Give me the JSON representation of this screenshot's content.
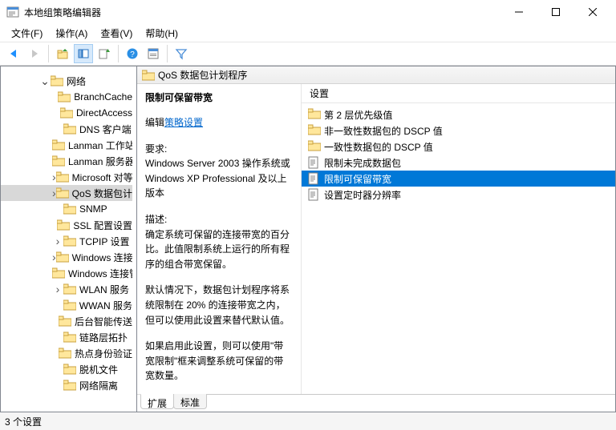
{
  "window": {
    "title": "本地组策略编辑器"
  },
  "menu": {
    "file": "文件(F)",
    "action": "操作(A)",
    "view": "查看(V)",
    "help": "帮助(H)"
  },
  "tree": {
    "root": "网络",
    "items": [
      "BranchCache",
      "DirectAccess",
      "DNS 客户端",
      "Lanman 工作站",
      "Lanman 服务器",
      "Microsoft 对等网络",
      "QoS 数据包计划程序",
      "SNMP",
      "SSL 配置设置",
      "TCPIP 设置",
      "Windows 连接",
      "Windows 连接管理器",
      "WLAN 服务",
      "WWAN 服务",
      "后台智能传送",
      "链路层拓扑",
      "热点身份验证",
      "脱机文件",
      "网络隔离"
    ]
  },
  "right": {
    "path": "QoS 数据包计划程序",
    "desc_title": "限制可保留带宽",
    "edit_prefix": "编辑",
    "edit_link": "策略设置",
    "req_label": "要求:",
    "req_text": "Windows Server 2003 操作系统或 Windows XP Professional 及以上版本",
    "desc_label": "描述:",
    "desc_p1": "确定系统可保留的连接带宽的百分比。此值限制系统上运行的所有程序的组合带宽保留。",
    "desc_p2": "默认情况下，数据包计划程序将系统限制在 20% 的连接带宽之内，但可以使用此设置来替代默认值。",
    "desc_p3": "如果启用此设置，则可以使用\"带宽限制\"框来调整系统可保留的带宽数量。",
    "settings_header": "设置",
    "settings": [
      {
        "type": "folder",
        "label": "第 2 层优先级值"
      },
      {
        "type": "folder",
        "label": "非一致性数据包的 DSCP 值"
      },
      {
        "type": "folder",
        "label": "一致性数据包的 DSCP 值"
      },
      {
        "type": "item",
        "label": "限制未完成数据包"
      },
      {
        "type": "item",
        "label": "限制可保留带宽",
        "selected": true
      },
      {
        "type": "item",
        "label": "设置定时器分辨率"
      }
    ],
    "tabs": {
      "extended": "扩展",
      "standard": "标准"
    }
  },
  "status": "3 个设置"
}
